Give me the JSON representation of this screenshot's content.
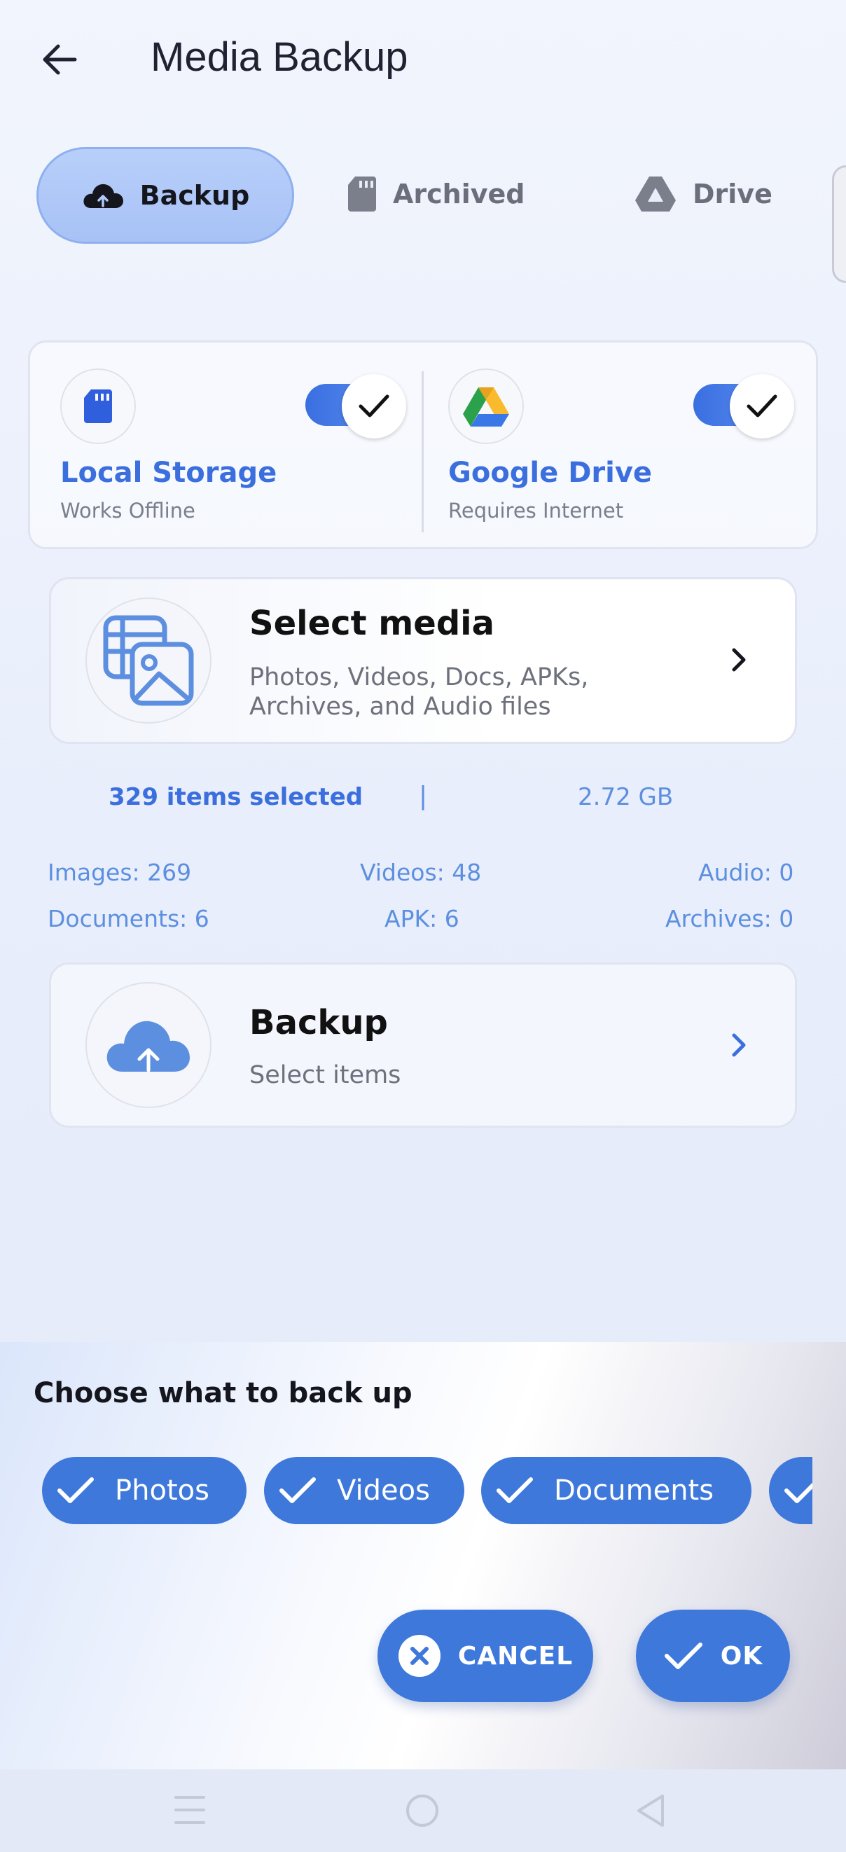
{
  "header": {
    "title": "Media Backup"
  },
  "tabs": [
    {
      "label": "Backup",
      "icon": "cloud-upload-icon",
      "active": true
    },
    {
      "label": "Archived",
      "icon": "sd-card-icon",
      "active": false
    },
    {
      "label": "Drive",
      "icon": "drive-icon",
      "active": false
    }
  ],
  "storage": {
    "local": {
      "title": "Local Storage",
      "subtitle": "Works Offline",
      "enabled": true
    },
    "drive": {
      "title": "Google Drive",
      "subtitle": "Requires Internet",
      "enabled": true
    }
  },
  "select_media": {
    "title": "Select media",
    "subtitle_line1": "Photos, Videos, Docs, APKs,",
    "subtitle_line2": "Archives, and Audio files"
  },
  "selection": {
    "count": "329 items selected",
    "separator": "|",
    "size": "2.72 GB"
  },
  "stats": {
    "images": "Images: 269",
    "videos": "Videos: 48",
    "audio": "Audio: 0",
    "documents": "Documents: 6",
    "apk": "APK: 6",
    "archives": "Archives: 0"
  },
  "backup_card": {
    "title": "Backup",
    "subtitle": "Select items"
  },
  "sheet": {
    "title": "Choose what to back up",
    "chips": [
      "Photos",
      "Videos",
      "Documents"
    ],
    "cancel_label": "CANCEL",
    "ok_label": "OK"
  },
  "colors": {
    "accent": "#3e78da",
    "title_blue": "#3c6fde",
    "stat_blue": "#5d8fe0"
  }
}
